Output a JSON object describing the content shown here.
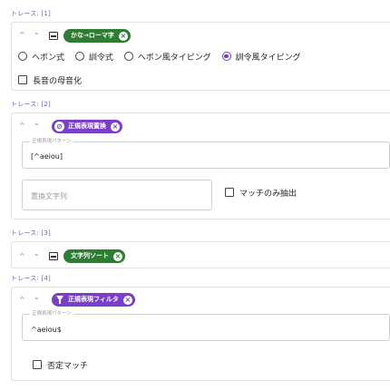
{
  "traces": [
    {
      "label": "トレース: [1]",
      "chip": "かな→ローマ字",
      "options": [
        {
          "label": "ヘボン式",
          "checked": false
        },
        {
          "label": "訓令式",
          "checked": false
        },
        {
          "label": "ヘボン風タイピング",
          "checked": false
        },
        {
          "label": "訓令風タイピング",
          "checked": true
        }
      ],
      "checkbox_label": "長音の母音化"
    },
    {
      "label": "トレース: [2]",
      "chip": "正規表現置換",
      "pattern_legend": "正規表現パターン",
      "pattern_value": "[^aeiou]",
      "replace_placeholder": "置換文字列",
      "checkbox_label": "マッチのみ抽出"
    },
    {
      "label": "トレース: [3]",
      "chip": "文字列ソート"
    },
    {
      "label": "トレース: [4]",
      "chip": "正規表現フィルタ",
      "pattern_legend": "正規表現パターン",
      "pattern_value": "^aeiou$",
      "checkbox_label": "否定マッチ"
    }
  ],
  "controls": {
    "up": "^",
    "down": "⌄",
    "close": "×",
    "regex_icon": "⊘"
  },
  "colors": {
    "green_chip": "#2e7d32",
    "purple_chip": "#7a3ec9",
    "trace_label": "#7b5ea7"
  }
}
